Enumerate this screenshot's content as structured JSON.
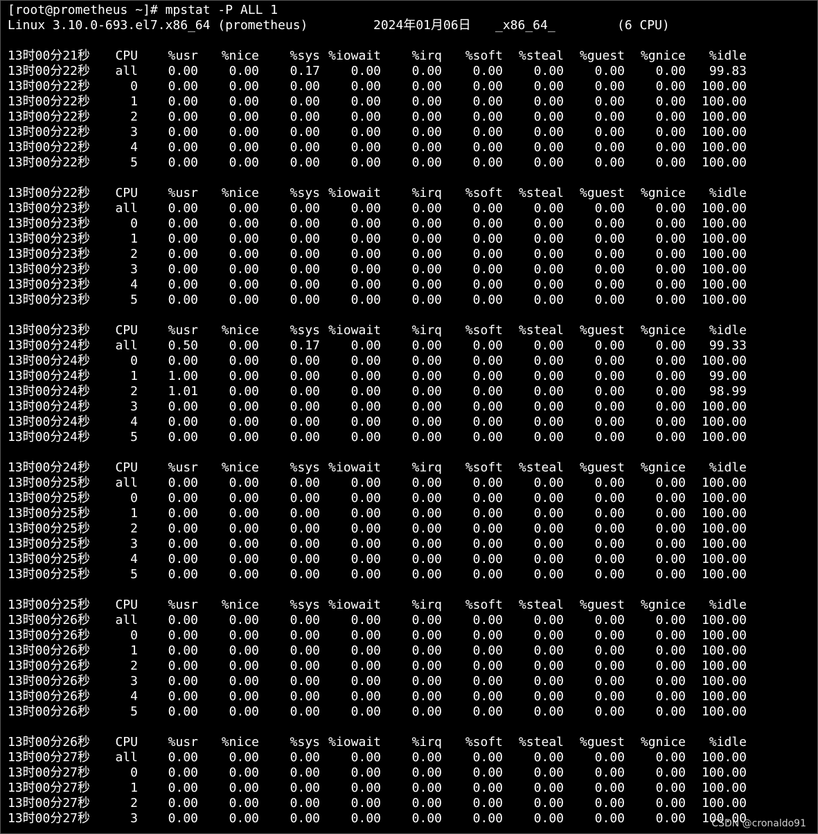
{
  "terminal": {
    "prompt_line": "[root@prometheus ~]# mpstat -P ALL 1",
    "info_line": {
      "kernel": "Linux 3.10.0-693.el7.x86_64 (prometheus)",
      "date": "2024年01月06日",
      "arch": "_x86_64_",
      "cpus": "(6 CPU)"
    },
    "columns": [
      "CPU",
      "%usr",
      "%nice",
      "%sys",
      "%iowait",
      "%irq",
      "%soft",
      "%steal",
      "%guest",
      "%gnice",
      "%idle"
    ],
    "blocks": [
      {
        "header_time": "13时00分21秒",
        "rows": [
          [
            "13时00分22秒",
            "all",
            "0.00",
            "0.00",
            "0.17",
            "0.00",
            "0.00",
            "0.00",
            "0.00",
            "0.00",
            "0.00",
            "99.83"
          ],
          [
            "13时00分22秒",
            "0",
            "0.00",
            "0.00",
            "0.00",
            "0.00",
            "0.00",
            "0.00",
            "0.00",
            "0.00",
            "0.00",
            "100.00"
          ],
          [
            "13时00分22秒",
            "1",
            "0.00",
            "0.00",
            "0.00",
            "0.00",
            "0.00",
            "0.00",
            "0.00",
            "0.00",
            "0.00",
            "100.00"
          ],
          [
            "13时00分22秒",
            "2",
            "0.00",
            "0.00",
            "0.00",
            "0.00",
            "0.00",
            "0.00",
            "0.00",
            "0.00",
            "0.00",
            "100.00"
          ],
          [
            "13时00分22秒",
            "3",
            "0.00",
            "0.00",
            "0.00",
            "0.00",
            "0.00",
            "0.00",
            "0.00",
            "0.00",
            "0.00",
            "100.00"
          ],
          [
            "13时00分22秒",
            "4",
            "0.00",
            "0.00",
            "0.00",
            "0.00",
            "0.00",
            "0.00",
            "0.00",
            "0.00",
            "0.00",
            "100.00"
          ],
          [
            "13时00分22秒",
            "5",
            "0.00",
            "0.00",
            "0.00",
            "0.00",
            "0.00",
            "0.00",
            "0.00",
            "0.00",
            "0.00",
            "100.00"
          ]
        ]
      },
      {
        "header_time": "13时00分22秒",
        "rows": [
          [
            "13时00分23秒",
            "all",
            "0.00",
            "0.00",
            "0.00",
            "0.00",
            "0.00",
            "0.00",
            "0.00",
            "0.00",
            "0.00",
            "100.00"
          ],
          [
            "13时00分23秒",
            "0",
            "0.00",
            "0.00",
            "0.00",
            "0.00",
            "0.00",
            "0.00",
            "0.00",
            "0.00",
            "0.00",
            "100.00"
          ],
          [
            "13时00分23秒",
            "1",
            "0.00",
            "0.00",
            "0.00",
            "0.00",
            "0.00",
            "0.00",
            "0.00",
            "0.00",
            "0.00",
            "100.00"
          ],
          [
            "13时00分23秒",
            "2",
            "0.00",
            "0.00",
            "0.00",
            "0.00",
            "0.00",
            "0.00",
            "0.00",
            "0.00",
            "0.00",
            "100.00"
          ],
          [
            "13时00分23秒",
            "3",
            "0.00",
            "0.00",
            "0.00",
            "0.00",
            "0.00",
            "0.00",
            "0.00",
            "0.00",
            "0.00",
            "100.00"
          ],
          [
            "13时00分23秒",
            "4",
            "0.00",
            "0.00",
            "0.00",
            "0.00",
            "0.00",
            "0.00",
            "0.00",
            "0.00",
            "0.00",
            "100.00"
          ],
          [
            "13时00分23秒",
            "5",
            "0.00",
            "0.00",
            "0.00",
            "0.00",
            "0.00",
            "0.00",
            "0.00",
            "0.00",
            "0.00",
            "100.00"
          ]
        ]
      },
      {
        "header_time": "13时00分23秒",
        "rows": [
          [
            "13时00分24秒",
            "all",
            "0.50",
            "0.00",
            "0.17",
            "0.00",
            "0.00",
            "0.00",
            "0.00",
            "0.00",
            "0.00",
            "99.33"
          ],
          [
            "13时00分24秒",
            "0",
            "0.00",
            "0.00",
            "0.00",
            "0.00",
            "0.00",
            "0.00",
            "0.00",
            "0.00",
            "0.00",
            "100.00"
          ],
          [
            "13时00分24秒",
            "1",
            "1.00",
            "0.00",
            "0.00",
            "0.00",
            "0.00",
            "0.00",
            "0.00",
            "0.00",
            "0.00",
            "99.00"
          ],
          [
            "13时00分24秒",
            "2",
            "1.01",
            "0.00",
            "0.00",
            "0.00",
            "0.00",
            "0.00",
            "0.00",
            "0.00",
            "0.00",
            "98.99"
          ],
          [
            "13时00分24秒",
            "3",
            "0.00",
            "0.00",
            "0.00",
            "0.00",
            "0.00",
            "0.00",
            "0.00",
            "0.00",
            "0.00",
            "100.00"
          ],
          [
            "13时00分24秒",
            "4",
            "0.00",
            "0.00",
            "0.00",
            "0.00",
            "0.00",
            "0.00",
            "0.00",
            "0.00",
            "0.00",
            "100.00"
          ],
          [
            "13时00分24秒",
            "5",
            "0.00",
            "0.00",
            "0.00",
            "0.00",
            "0.00",
            "0.00",
            "0.00",
            "0.00",
            "0.00",
            "100.00"
          ]
        ]
      },
      {
        "header_time": "13时00分24秒",
        "rows": [
          [
            "13时00分25秒",
            "all",
            "0.00",
            "0.00",
            "0.00",
            "0.00",
            "0.00",
            "0.00",
            "0.00",
            "0.00",
            "0.00",
            "100.00"
          ],
          [
            "13时00分25秒",
            "0",
            "0.00",
            "0.00",
            "0.00",
            "0.00",
            "0.00",
            "0.00",
            "0.00",
            "0.00",
            "0.00",
            "100.00"
          ],
          [
            "13时00分25秒",
            "1",
            "0.00",
            "0.00",
            "0.00",
            "0.00",
            "0.00",
            "0.00",
            "0.00",
            "0.00",
            "0.00",
            "100.00"
          ],
          [
            "13时00分25秒",
            "2",
            "0.00",
            "0.00",
            "0.00",
            "0.00",
            "0.00",
            "0.00",
            "0.00",
            "0.00",
            "0.00",
            "100.00"
          ],
          [
            "13时00分25秒",
            "3",
            "0.00",
            "0.00",
            "0.00",
            "0.00",
            "0.00",
            "0.00",
            "0.00",
            "0.00",
            "0.00",
            "100.00"
          ],
          [
            "13时00分25秒",
            "4",
            "0.00",
            "0.00",
            "0.00",
            "0.00",
            "0.00",
            "0.00",
            "0.00",
            "0.00",
            "0.00",
            "100.00"
          ],
          [
            "13时00分25秒",
            "5",
            "0.00",
            "0.00",
            "0.00",
            "0.00",
            "0.00",
            "0.00",
            "0.00",
            "0.00",
            "0.00",
            "100.00"
          ]
        ]
      },
      {
        "header_time": "13时00分25秒",
        "rows": [
          [
            "13时00分26秒",
            "all",
            "0.00",
            "0.00",
            "0.00",
            "0.00",
            "0.00",
            "0.00",
            "0.00",
            "0.00",
            "0.00",
            "100.00"
          ],
          [
            "13时00分26秒",
            "0",
            "0.00",
            "0.00",
            "0.00",
            "0.00",
            "0.00",
            "0.00",
            "0.00",
            "0.00",
            "0.00",
            "100.00"
          ],
          [
            "13时00分26秒",
            "1",
            "0.00",
            "0.00",
            "0.00",
            "0.00",
            "0.00",
            "0.00",
            "0.00",
            "0.00",
            "0.00",
            "100.00"
          ],
          [
            "13时00分26秒",
            "2",
            "0.00",
            "0.00",
            "0.00",
            "0.00",
            "0.00",
            "0.00",
            "0.00",
            "0.00",
            "0.00",
            "100.00"
          ],
          [
            "13时00分26秒",
            "3",
            "0.00",
            "0.00",
            "0.00",
            "0.00",
            "0.00",
            "0.00",
            "0.00",
            "0.00",
            "0.00",
            "100.00"
          ],
          [
            "13时00分26秒",
            "4",
            "0.00",
            "0.00",
            "0.00",
            "0.00",
            "0.00",
            "0.00",
            "0.00",
            "0.00",
            "0.00",
            "100.00"
          ],
          [
            "13时00分26秒",
            "5",
            "0.00",
            "0.00",
            "0.00",
            "0.00",
            "0.00",
            "0.00",
            "0.00",
            "0.00",
            "0.00",
            "100.00"
          ]
        ]
      },
      {
        "header_time": "13时00分26秒",
        "rows": [
          [
            "13时00分27秒",
            "all",
            "0.00",
            "0.00",
            "0.00",
            "0.00",
            "0.00",
            "0.00",
            "0.00",
            "0.00",
            "0.00",
            "100.00"
          ],
          [
            "13时00分27秒",
            "0",
            "0.00",
            "0.00",
            "0.00",
            "0.00",
            "0.00",
            "0.00",
            "0.00",
            "0.00",
            "0.00",
            "100.00"
          ],
          [
            "13时00分27秒",
            "1",
            "0.00",
            "0.00",
            "0.00",
            "0.00",
            "0.00",
            "0.00",
            "0.00",
            "0.00",
            "0.00",
            "100.00"
          ],
          [
            "13时00分27秒",
            "2",
            "0.00",
            "0.00",
            "0.00",
            "0.00",
            "0.00",
            "0.00",
            "0.00",
            "0.00",
            "0.00",
            "100.00"
          ],
          [
            "13时00分27秒",
            "3",
            "0.00",
            "0.00",
            "0.00",
            "0.00",
            "0.00",
            "0.00",
            "0.00",
            "0.00",
            "0.00",
            "100.00"
          ]
        ]
      }
    ]
  },
  "watermark": "CSDN @cronaldo91",
  "colors": {
    "background": "#000000",
    "text": "#ffffff"
  }
}
